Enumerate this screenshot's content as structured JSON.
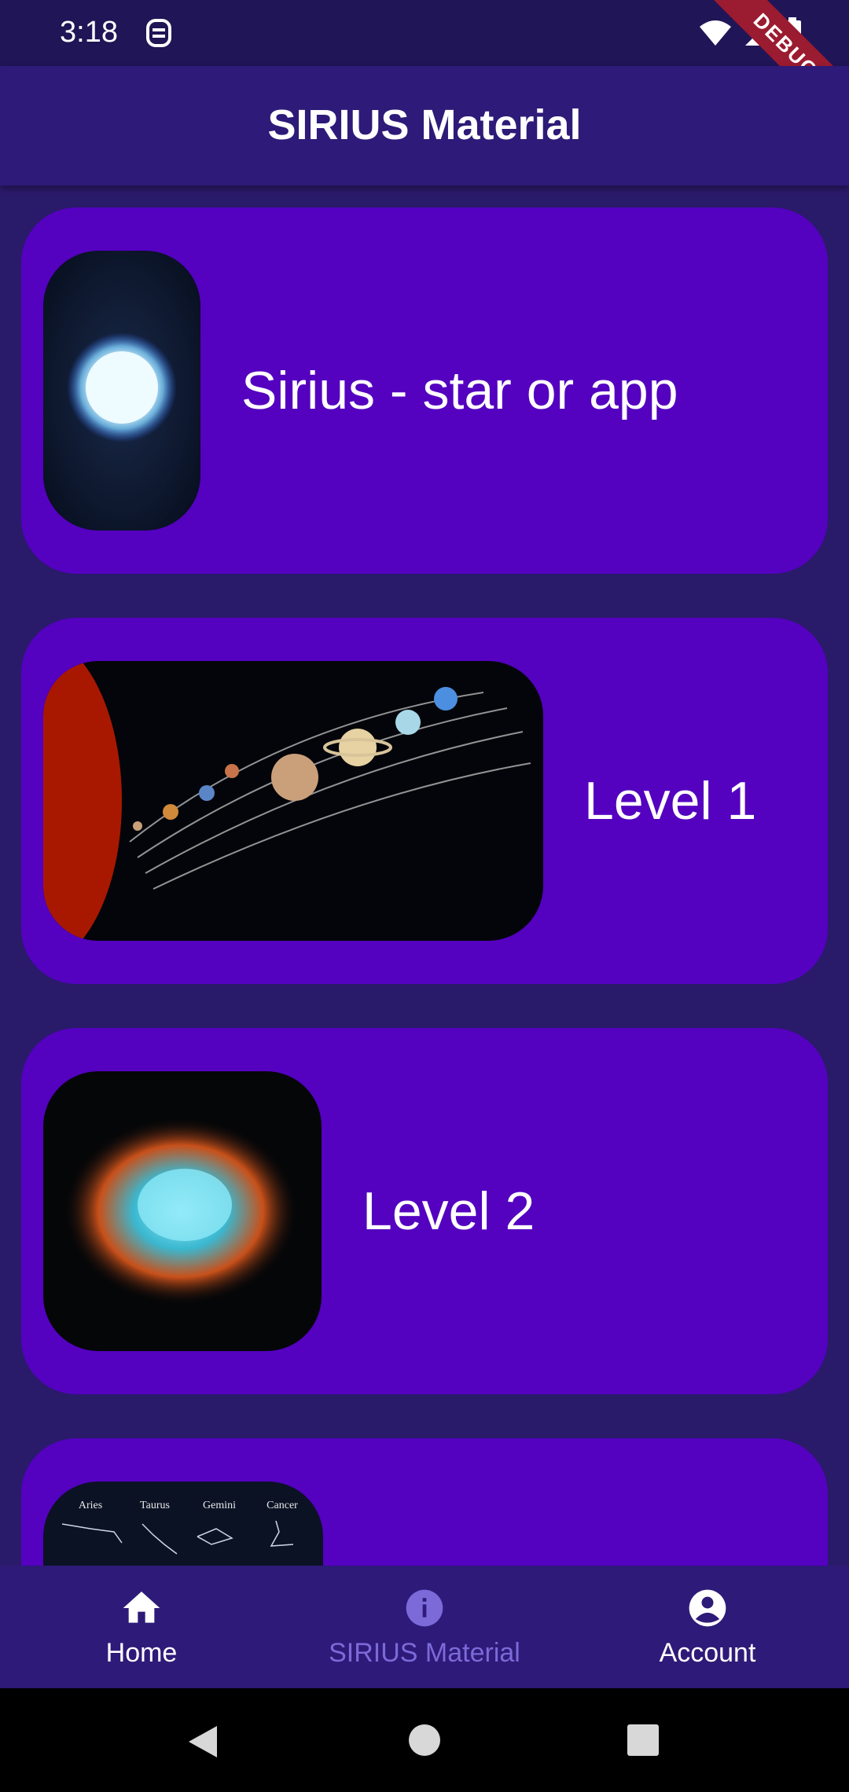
{
  "status_bar": {
    "time": "3:18",
    "debug_label": "DEBUG"
  },
  "app_bar": {
    "title": "SIRIUS Material"
  },
  "cards": [
    {
      "label": "Sirius - star or app",
      "image": "white-dwarf-star"
    },
    {
      "label": "Level 1",
      "image": "solar-system"
    },
    {
      "label": "Level 2",
      "image": "crab-nebula"
    },
    {
      "label": "",
      "image": "zodiac-constellations",
      "image_text": [
        "Aries",
        "Taurus",
        "Gemini",
        "Cancer"
      ]
    }
  ],
  "bottom_nav": {
    "items": [
      {
        "label": "Home",
        "icon": "home-icon"
      },
      {
        "label": "SIRIUS Material",
        "icon": "info-icon"
      },
      {
        "label": "Account",
        "icon": "account-icon"
      }
    ],
    "active_color": "#ffffff",
    "inactive_color": "#7b6ad8"
  },
  "colors": {
    "background": "#2a1a6a",
    "app_bar": "#2e1a78",
    "card": "#5401c0"
  }
}
